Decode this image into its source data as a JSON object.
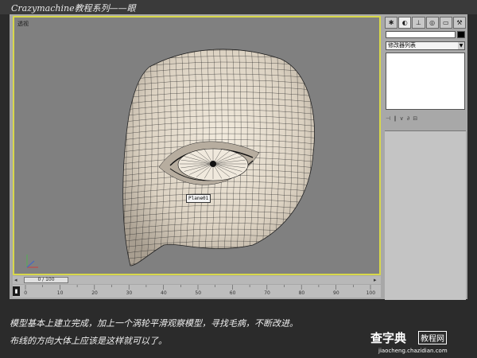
{
  "banner": {
    "title": "Crazymachine教程系列——眼"
  },
  "viewport": {
    "label": "透视",
    "object_tag": "Plane01"
  },
  "command_panel": {
    "tabs": [
      {
        "icon": "create-icon"
      },
      {
        "icon": "modify-icon"
      },
      {
        "icon": "hierarchy-icon"
      },
      {
        "icon": "motion-icon"
      },
      {
        "icon": "display-icon"
      },
      {
        "icon": "utilities-icon"
      }
    ],
    "active_tab": 1,
    "modifier_list": "修改器列表",
    "color_swatch": "#000000"
  },
  "timeline": {
    "slider_text": "0 / 100",
    "ticks": [
      "0",
      "10",
      "20",
      "30",
      "40",
      "50",
      "60",
      "70",
      "80",
      "90",
      "100"
    ]
  },
  "captions": {
    "line1": "模型基本上建立完成，加上一个涡轮平滑观察模型，寻找毛病，不断改进。",
    "line2": "布线的方向大体上应该是这样就可以了。"
  },
  "watermark": {
    "main": "查字典",
    "box": "教程网",
    "url": "jiaocheng.chazidian.com"
  },
  "colors": {
    "viewport_border": "#d8d84a",
    "viewport_bg": "#808080",
    "mesh_fill": "#e6dccd"
  }
}
